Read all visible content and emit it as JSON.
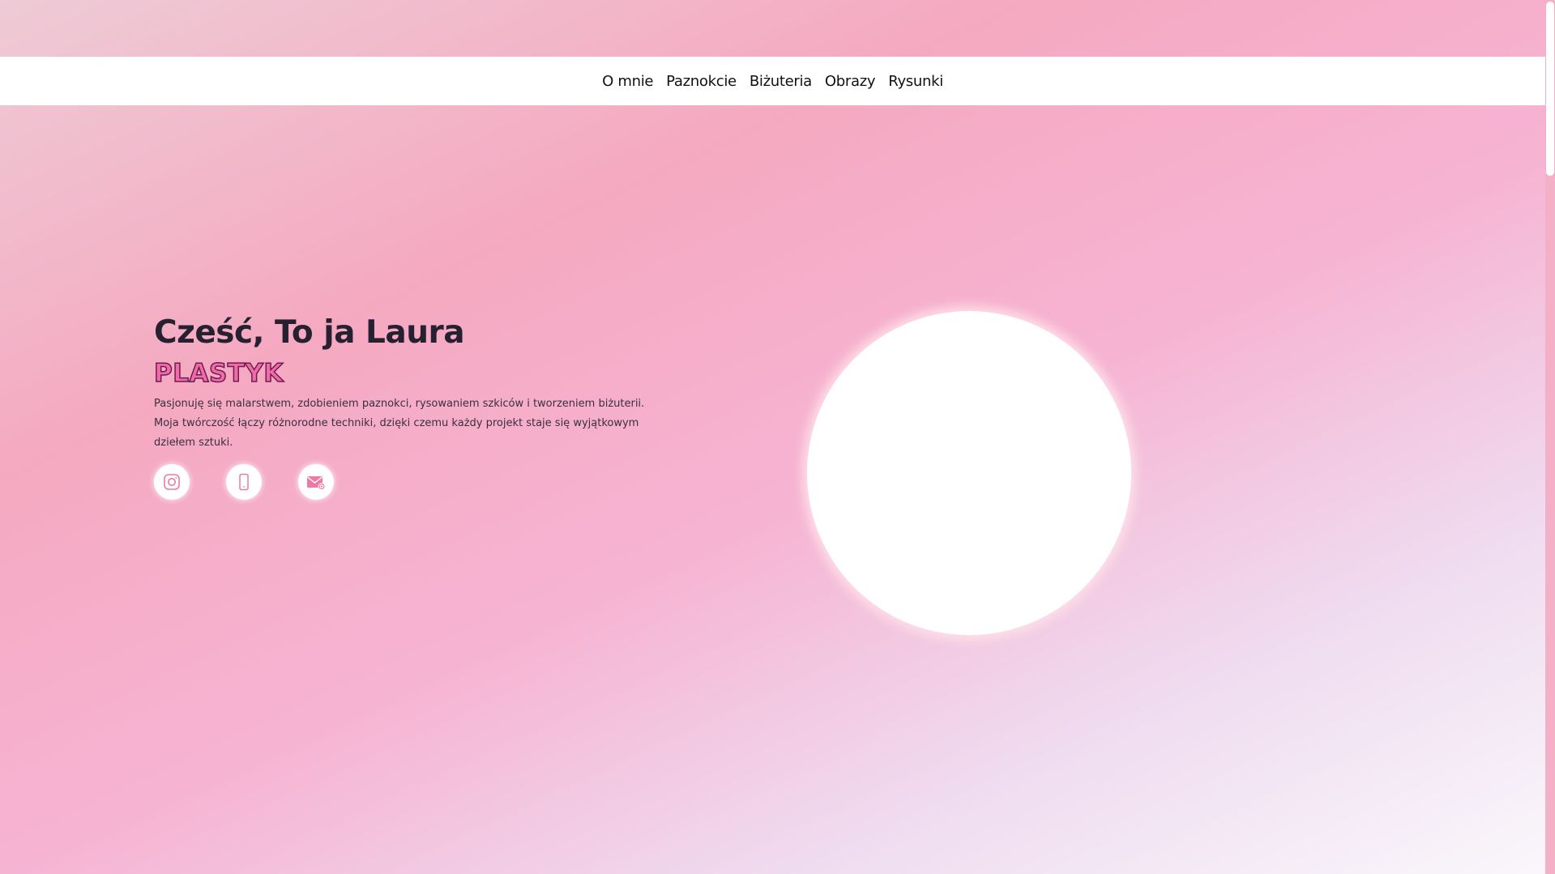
{
  "nav": {
    "items": [
      "O mnie",
      "Paznokcie",
      "Biżuteria",
      "Obrazy",
      "Rysunki"
    ]
  },
  "hero": {
    "greeting": "Cześć, To ja Laura",
    "role": "PLASTYK",
    "description": "Pasjonuję się malarstwem, zdobieniem paznokci, rysowaniem szkiców i tworzeniem biżuterii. Moja twórczość łączy różnorodne techniki, dzięki czemu każdy projekt staje się wyjątkowym dziełem sztuki."
  },
  "socials": [
    {
      "icon": "instagram-icon"
    },
    {
      "icon": "phone-icon"
    },
    {
      "icon": "mail-icon"
    }
  ],
  "colors": {
    "accent": "#f06aa0",
    "role_outline": "#6a1d53",
    "icon": "#ec7aa3"
  }
}
